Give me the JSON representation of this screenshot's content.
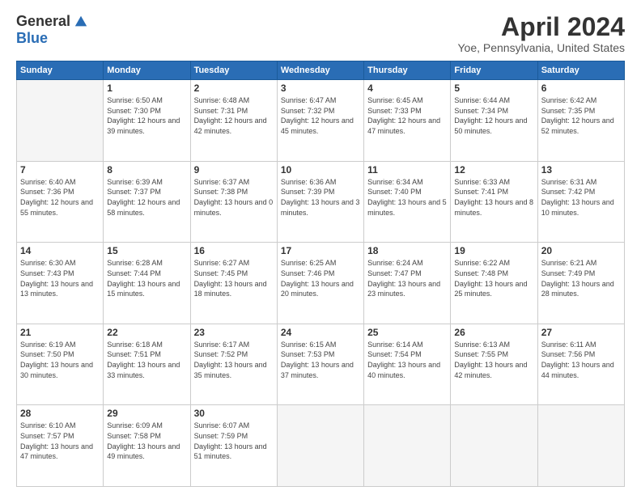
{
  "header": {
    "logo_general": "General",
    "logo_blue": "Blue",
    "title": "April 2024",
    "location": "Yoe, Pennsylvania, United States"
  },
  "days_of_week": [
    "Sunday",
    "Monday",
    "Tuesday",
    "Wednesday",
    "Thursday",
    "Friday",
    "Saturday"
  ],
  "weeks": [
    [
      {
        "day": "",
        "sunrise": "",
        "sunset": "",
        "daylight": ""
      },
      {
        "day": "1",
        "sunrise": "Sunrise: 6:50 AM",
        "sunset": "Sunset: 7:30 PM",
        "daylight": "Daylight: 12 hours and 39 minutes."
      },
      {
        "day": "2",
        "sunrise": "Sunrise: 6:48 AM",
        "sunset": "Sunset: 7:31 PM",
        "daylight": "Daylight: 12 hours and 42 minutes."
      },
      {
        "day": "3",
        "sunrise": "Sunrise: 6:47 AM",
        "sunset": "Sunset: 7:32 PM",
        "daylight": "Daylight: 12 hours and 45 minutes."
      },
      {
        "day": "4",
        "sunrise": "Sunrise: 6:45 AM",
        "sunset": "Sunset: 7:33 PM",
        "daylight": "Daylight: 12 hours and 47 minutes."
      },
      {
        "day": "5",
        "sunrise": "Sunrise: 6:44 AM",
        "sunset": "Sunset: 7:34 PM",
        "daylight": "Daylight: 12 hours and 50 minutes."
      },
      {
        "day": "6",
        "sunrise": "Sunrise: 6:42 AM",
        "sunset": "Sunset: 7:35 PM",
        "daylight": "Daylight: 12 hours and 52 minutes."
      }
    ],
    [
      {
        "day": "7",
        "sunrise": "Sunrise: 6:40 AM",
        "sunset": "Sunset: 7:36 PM",
        "daylight": "Daylight: 12 hours and 55 minutes."
      },
      {
        "day": "8",
        "sunrise": "Sunrise: 6:39 AM",
        "sunset": "Sunset: 7:37 PM",
        "daylight": "Daylight: 12 hours and 58 minutes."
      },
      {
        "day": "9",
        "sunrise": "Sunrise: 6:37 AM",
        "sunset": "Sunset: 7:38 PM",
        "daylight": "Daylight: 13 hours and 0 minutes."
      },
      {
        "day": "10",
        "sunrise": "Sunrise: 6:36 AM",
        "sunset": "Sunset: 7:39 PM",
        "daylight": "Daylight: 13 hours and 3 minutes."
      },
      {
        "day": "11",
        "sunrise": "Sunrise: 6:34 AM",
        "sunset": "Sunset: 7:40 PM",
        "daylight": "Daylight: 13 hours and 5 minutes."
      },
      {
        "day": "12",
        "sunrise": "Sunrise: 6:33 AM",
        "sunset": "Sunset: 7:41 PM",
        "daylight": "Daylight: 13 hours and 8 minutes."
      },
      {
        "day": "13",
        "sunrise": "Sunrise: 6:31 AM",
        "sunset": "Sunset: 7:42 PM",
        "daylight": "Daylight: 13 hours and 10 minutes."
      }
    ],
    [
      {
        "day": "14",
        "sunrise": "Sunrise: 6:30 AM",
        "sunset": "Sunset: 7:43 PM",
        "daylight": "Daylight: 13 hours and 13 minutes."
      },
      {
        "day": "15",
        "sunrise": "Sunrise: 6:28 AM",
        "sunset": "Sunset: 7:44 PM",
        "daylight": "Daylight: 13 hours and 15 minutes."
      },
      {
        "day": "16",
        "sunrise": "Sunrise: 6:27 AM",
        "sunset": "Sunset: 7:45 PM",
        "daylight": "Daylight: 13 hours and 18 minutes."
      },
      {
        "day": "17",
        "sunrise": "Sunrise: 6:25 AM",
        "sunset": "Sunset: 7:46 PM",
        "daylight": "Daylight: 13 hours and 20 minutes."
      },
      {
        "day": "18",
        "sunrise": "Sunrise: 6:24 AM",
        "sunset": "Sunset: 7:47 PM",
        "daylight": "Daylight: 13 hours and 23 minutes."
      },
      {
        "day": "19",
        "sunrise": "Sunrise: 6:22 AM",
        "sunset": "Sunset: 7:48 PM",
        "daylight": "Daylight: 13 hours and 25 minutes."
      },
      {
        "day": "20",
        "sunrise": "Sunrise: 6:21 AM",
        "sunset": "Sunset: 7:49 PM",
        "daylight": "Daylight: 13 hours and 28 minutes."
      }
    ],
    [
      {
        "day": "21",
        "sunrise": "Sunrise: 6:19 AM",
        "sunset": "Sunset: 7:50 PM",
        "daylight": "Daylight: 13 hours and 30 minutes."
      },
      {
        "day": "22",
        "sunrise": "Sunrise: 6:18 AM",
        "sunset": "Sunset: 7:51 PM",
        "daylight": "Daylight: 13 hours and 33 minutes."
      },
      {
        "day": "23",
        "sunrise": "Sunrise: 6:17 AM",
        "sunset": "Sunset: 7:52 PM",
        "daylight": "Daylight: 13 hours and 35 minutes."
      },
      {
        "day": "24",
        "sunrise": "Sunrise: 6:15 AM",
        "sunset": "Sunset: 7:53 PM",
        "daylight": "Daylight: 13 hours and 37 minutes."
      },
      {
        "day": "25",
        "sunrise": "Sunrise: 6:14 AM",
        "sunset": "Sunset: 7:54 PM",
        "daylight": "Daylight: 13 hours and 40 minutes."
      },
      {
        "day": "26",
        "sunrise": "Sunrise: 6:13 AM",
        "sunset": "Sunset: 7:55 PM",
        "daylight": "Daylight: 13 hours and 42 minutes."
      },
      {
        "day": "27",
        "sunrise": "Sunrise: 6:11 AM",
        "sunset": "Sunset: 7:56 PM",
        "daylight": "Daylight: 13 hours and 44 minutes."
      }
    ],
    [
      {
        "day": "28",
        "sunrise": "Sunrise: 6:10 AM",
        "sunset": "Sunset: 7:57 PM",
        "daylight": "Daylight: 13 hours and 47 minutes."
      },
      {
        "day": "29",
        "sunrise": "Sunrise: 6:09 AM",
        "sunset": "Sunset: 7:58 PM",
        "daylight": "Daylight: 13 hours and 49 minutes."
      },
      {
        "day": "30",
        "sunrise": "Sunrise: 6:07 AM",
        "sunset": "Sunset: 7:59 PM",
        "daylight": "Daylight: 13 hours and 51 minutes."
      },
      {
        "day": "",
        "sunrise": "",
        "sunset": "",
        "daylight": ""
      },
      {
        "day": "",
        "sunrise": "",
        "sunset": "",
        "daylight": ""
      },
      {
        "day": "",
        "sunrise": "",
        "sunset": "",
        "daylight": ""
      },
      {
        "day": "",
        "sunrise": "",
        "sunset": "",
        "daylight": ""
      }
    ]
  ]
}
